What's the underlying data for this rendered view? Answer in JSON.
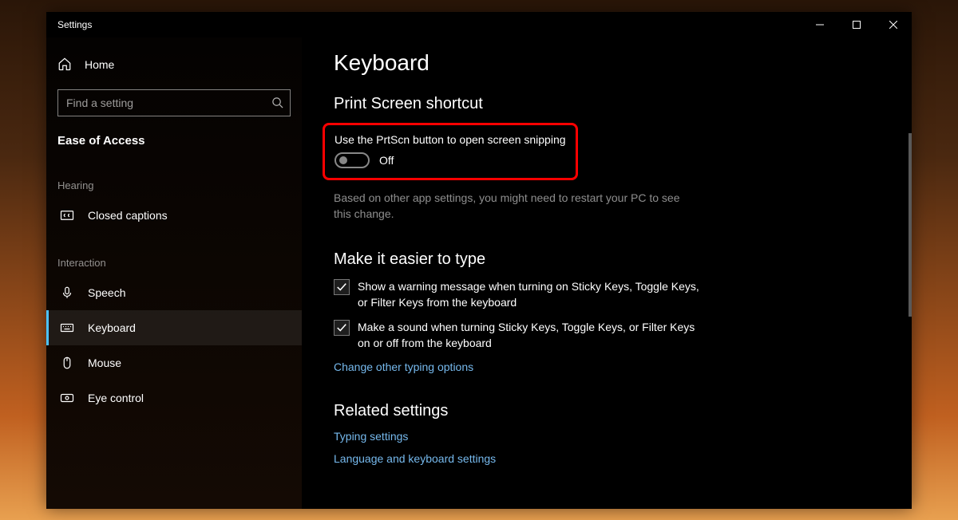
{
  "window": {
    "title": "Settings"
  },
  "sidebar": {
    "home": "Home",
    "search_placeholder": "Find a setting",
    "category": "Ease of Access",
    "groups": [
      {
        "label": "Hearing",
        "items": [
          {
            "key": "closed-captions",
            "label": "Closed captions"
          }
        ]
      },
      {
        "label": "Interaction",
        "items": [
          {
            "key": "speech",
            "label": "Speech"
          },
          {
            "key": "keyboard",
            "label": "Keyboard",
            "selected": true
          },
          {
            "key": "mouse",
            "label": "Mouse"
          },
          {
            "key": "eye-control",
            "label": "Eye control"
          }
        ]
      }
    ]
  },
  "main": {
    "title": "Keyboard",
    "section_prtscn": {
      "heading": "Print Screen shortcut",
      "toggle_label": "Use the PrtScn button to open screen snipping",
      "toggle_state": "Off",
      "hint": "Based on other app settings, you might need to restart your PC to see this change."
    },
    "section_type": {
      "heading": "Make it easier to type",
      "checks": [
        "Show a warning message when turning on Sticky Keys, Toggle Keys, or Filter Keys from the keyboard",
        "Make a sound when turning Sticky Keys, Toggle Keys, or Filter Keys on or off from the keyboard"
      ],
      "link": "Change other typing options"
    },
    "section_related": {
      "heading": "Related settings",
      "links": [
        "Typing settings",
        "Language and keyboard settings"
      ]
    }
  }
}
